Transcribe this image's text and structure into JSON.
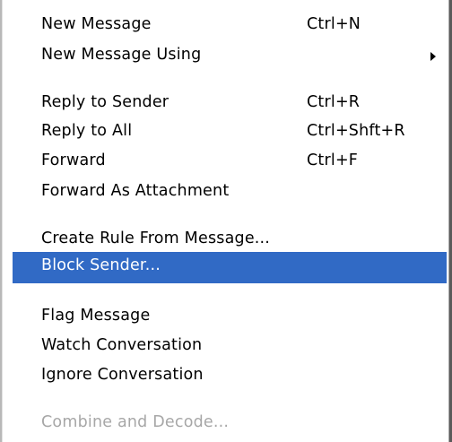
{
  "menu": {
    "items": [
      {
        "label": "New Message",
        "shortcut": "Ctrl+N"
      },
      {
        "label": "New Message Using",
        "shortcut": "",
        "submenu": true
      },
      {
        "label": "Reply to Sender",
        "shortcut": "Ctrl+R"
      },
      {
        "label": "Reply to All",
        "shortcut": "Ctrl+Shft+R"
      },
      {
        "label": "Forward",
        "shortcut": "Ctrl+F"
      },
      {
        "label": "Forward As Attachment",
        "shortcut": ""
      },
      {
        "label": "Create Rule From Message...",
        "shortcut": ""
      },
      {
        "label": "Block Sender...",
        "shortcut": "",
        "highlighted": true
      },
      {
        "label": "Flag Message",
        "shortcut": ""
      },
      {
        "label": "Watch Conversation",
        "shortcut": ""
      },
      {
        "label": "Ignore Conversation",
        "shortcut": ""
      },
      {
        "label": "Combine and Decode...",
        "shortcut": "",
        "disabled": true
      }
    ]
  },
  "colors": {
    "highlight_bg": "#316ac5",
    "highlight_text": "#ffffff",
    "disabled_text": "#a7a7a7"
  },
  "icons": {
    "submenu_arrow": "submenu-arrow-icon"
  }
}
